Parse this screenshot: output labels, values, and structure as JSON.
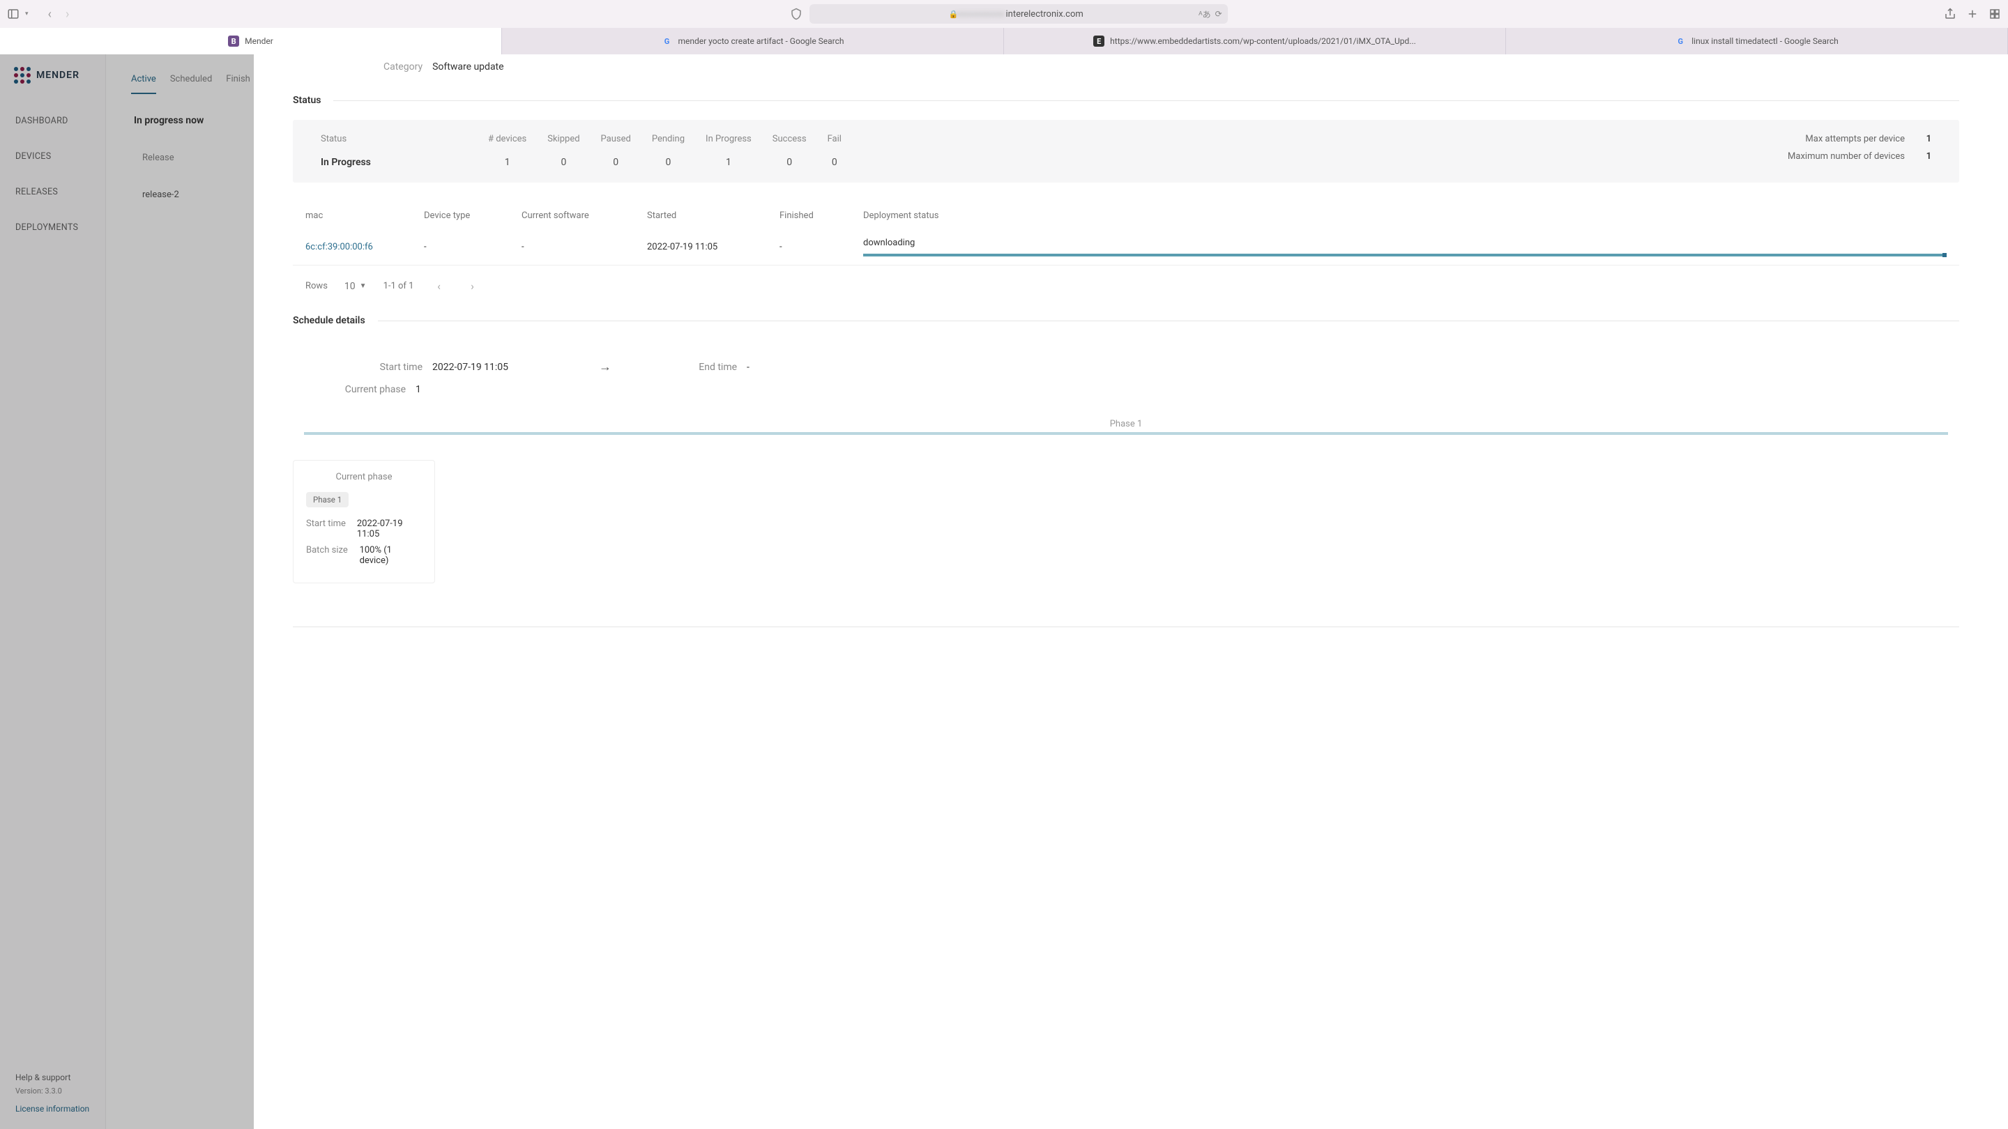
{
  "browser": {
    "url_domain": "interelectronix.com",
    "url_prefix_blur": "xxxxxxxxxxx",
    "tabs": [
      {
        "label": "Mender"
      },
      {
        "label": "mender yocto create artifact - Google Search"
      },
      {
        "label": "https://www.embeddedartists.com/wp-content/uploads/2021/01/iMX_OTA_Upd..."
      },
      {
        "label": "linux install timedatectl - Google Search"
      }
    ]
  },
  "sidebar": {
    "brand": "MENDER",
    "items": [
      "DASHBOARD",
      "DEVICES",
      "RELEASES",
      "DEPLOYMENTS"
    ],
    "help": "Help & support",
    "version": "Version: 3.3.0",
    "license": "License information"
  },
  "back_panel": {
    "tabs": [
      "Active",
      "Scheduled",
      "Finish"
    ],
    "heading": "In progress now",
    "release_label": "Release",
    "release_value": "release-2"
  },
  "sheet": {
    "category_label": "Category",
    "category_value": "Software update",
    "status_title": "Status",
    "status_block": {
      "label": "Status",
      "value": "In Progress",
      "cols": [
        "# devices",
        "Skipped",
        "Paused",
        "Pending",
        "In Progress",
        "Success",
        "Fail"
      ],
      "nums": [
        "1",
        "0",
        "0",
        "0",
        "1",
        "0",
        "0"
      ],
      "max_attempts_label": "Max attempts per device",
      "max_attempts_value": "1",
      "max_devices_label": "Maximum number of devices",
      "max_devices_value": "1"
    },
    "table": {
      "headers": [
        "mac",
        "Device type",
        "Current software",
        "Started",
        "Finished",
        "Deployment status"
      ],
      "row": {
        "mac": "6c:cf:39:00:00:f6",
        "device_type": "-",
        "current_sw": "-",
        "started": "2022-07-19 11:05",
        "finished": "-",
        "status": "downloading"
      }
    },
    "pagination": {
      "rows_label": "Rows",
      "rows_value": "10",
      "range": "1-1 of 1"
    },
    "schedule": {
      "title": "Schedule details",
      "start_label": "Start time",
      "start_value": "2022-07-19 11:05",
      "end_label": "End time",
      "end_value": "-",
      "phase_label": "Current phase",
      "phase_value": "1",
      "phase_header": "Phase 1"
    },
    "phase_card": {
      "title": "Current phase",
      "badge": "Phase 1",
      "start_label": "Start time",
      "start_value": "2022-07-19 11:05",
      "batch_label": "Batch size",
      "batch_value": "100% (1 device)"
    }
  }
}
